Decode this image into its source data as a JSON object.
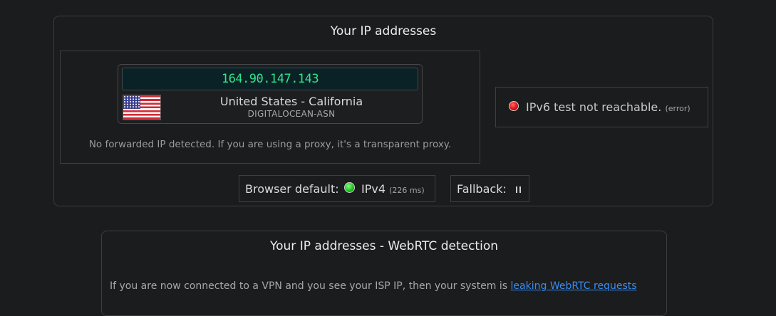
{
  "ip_panel": {
    "title": "Your IP addresses",
    "ipv4": {
      "address": "164.90.147.143",
      "location": "United States - California",
      "asn": "DIGITALOCEAN-ASN",
      "flag_icon": "us-flag-icon",
      "forward_note": "No forwarded IP detected. If you are using a proxy, it's a transparent proxy."
    },
    "ipv6": {
      "status_icon": "red-status-dot",
      "status_text": "IPv6 test not reachable.",
      "status_detail": "(error)"
    },
    "browser_default": {
      "label": "Browser default:",
      "status_icon": "green-status-dot",
      "protocol": "IPv4",
      "latency": "(226 ms)"
    },
    "fallback": {
      "label": "Fallback:",
      "status_icon": "loading-icon"
    }
  },
  "webrtc_panel": {
    "title": "Your IP addresses - WebRTC detection",
    "note_text": "If you are now connected to a VPN and you see your ISP IP, then your system is",
    "note_link": "leaking WebRTC requests"
  },
  "colors": {
    "background": "#1b1c1d",
    "ip_text": "#33e38a",
    "link": "#3a8df0",
    "ok": "#22c322",
    "error": "#e01010"
  }
}
